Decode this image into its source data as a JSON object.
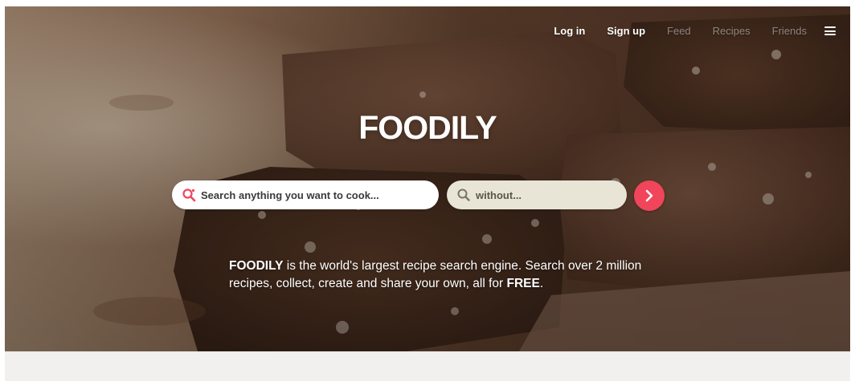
{
  "nav": {
    "login_label": "Log in",
    "signup_label": "Sign up",
    "feed_label": "Feed",
    "recipes_label": "Recipes",
    "friends_label": "Friends",
    "menu_icon": "hamburger-menu-icon"
  },
  "hero": {
    "logo_text": "FOODILY",
    "background_image": "brownies-photo"
  },
  "search": {
    "main_placeholder": "Search anything you want to cook...",
    "main_value": "",
    "main_icon": "search-icon",
    "without_placeholder": "without...",
    "without_value": "",
    "without_icon": "search-icon",
    "submit_icon": "chevron-right-icon"
  },
  "tagline": {
    "brand": "FOODILY",
    "line_part1": " is the world's largest recipe search engine. Search over 2 million recipes, collect, create and share your own, all for ",
    "emphasis": "FREE",
    "end": "."
  },
  "colors": {
    "accent": "#f0455a",
    "without_field_bg": "#e8e4d6",
    "hero_brown": "#6a4a35",
    "footer_bg": "#f1f0ee"
  }
}
